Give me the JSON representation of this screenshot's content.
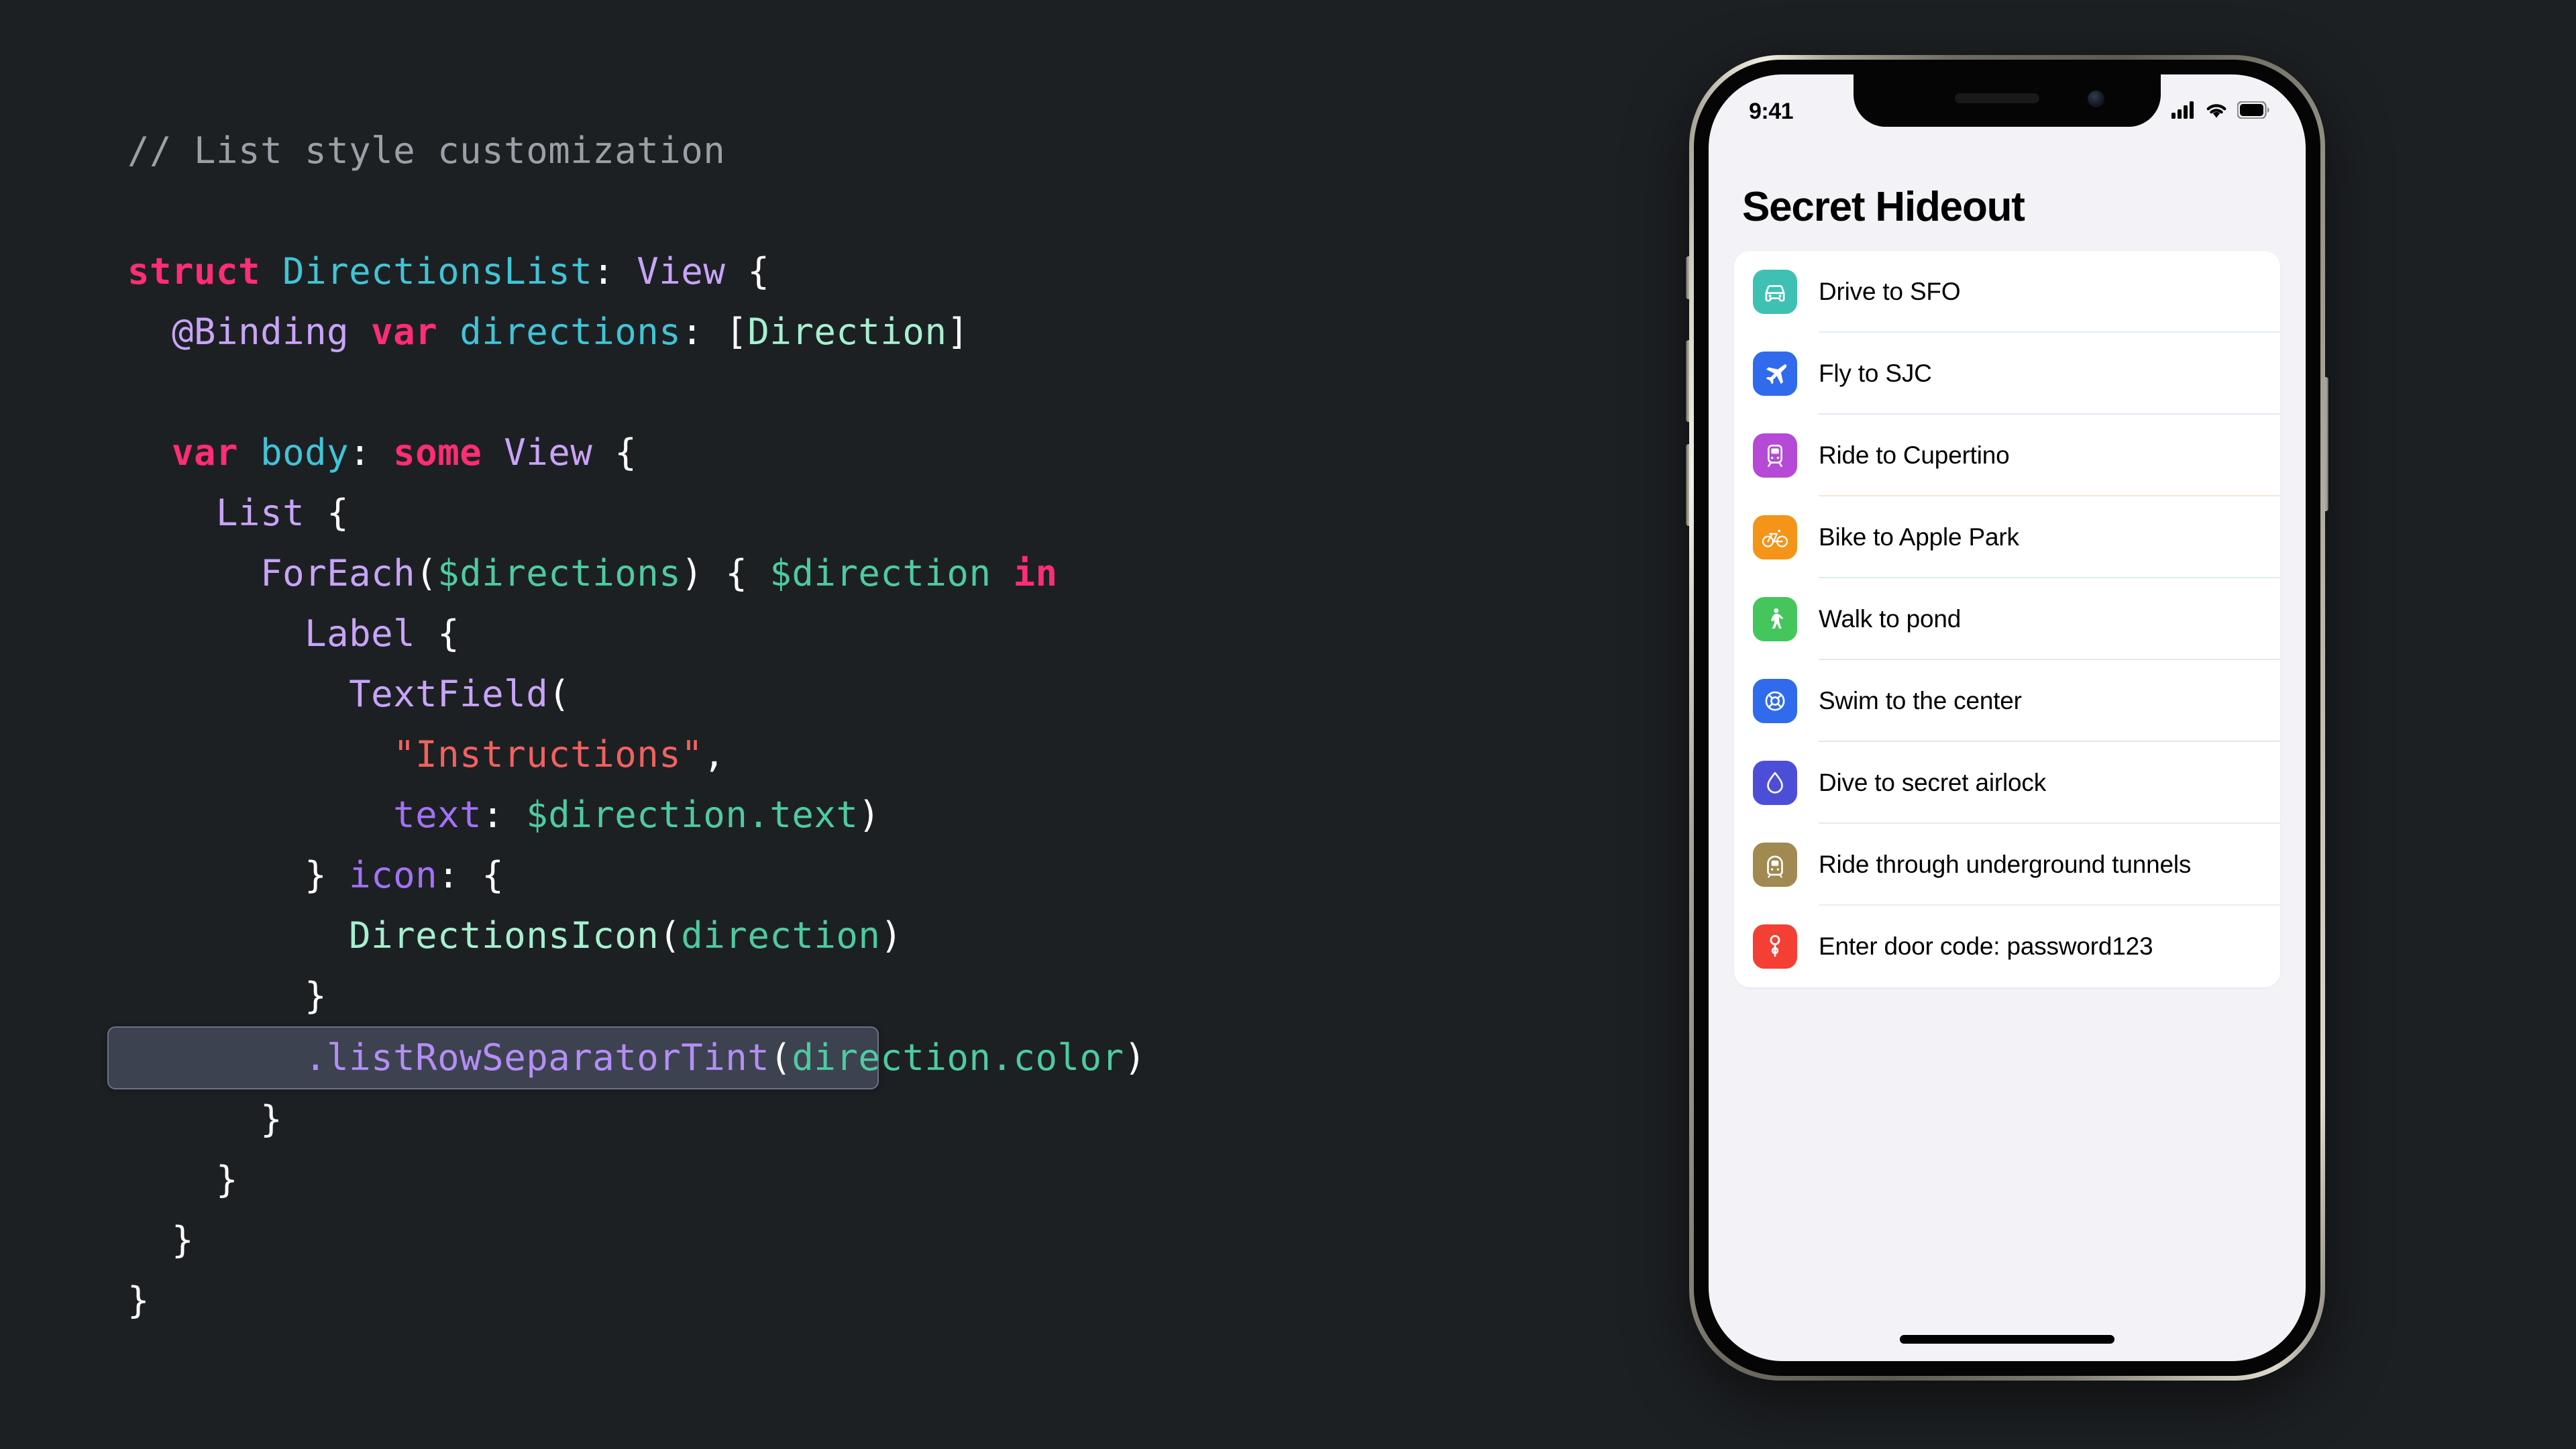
{
  "theme": {
    "background": "#1d2023",
    "code_text": "#ffffff",
    "highlight_bg": "#3d4250",
    "highlight_border": "#6b7287"
  },
  "code": {
    "language": "Swift",
    "lines": [
      {
        "id": "l1",
        "indent": 0,
        "highlighted": false,
        "tokens": [
          {
            "t": "// List style customization",
            "c": "tok-comment"
          }
        ]
      },
      {
        "id": "l2",
        "indent": 0,
        "highlighted": false,
        "blank": true,
        "tokens": [
          {
            "t": " ",
            "c": "tok-plain"
          }
        ]
      },
      {
        "id": "l3",
        "indent": 0,
        "highlighted": false,
        "tokens": [
          {
            "t": "struct",
            "c": "tok-keyword"
          },
          {
            "t": " ",
            "c": "tok-plain"
          },
          {
            "t": "DirectionsList",
            "c": "tok-type"
          },
          {
            "t": ": ",
            "c": "tok-plain"
          },
          {
            "t": "View",
            "c": "tok-viewtype"
          },
          {
            "t": " {",
            "c": "tok-plain"
          }
        ]
      },
      {
        "id": "l4",
        "indent": 1,
        "highlighted": false,
        "tokens": [
          {
            "t": "@Binding",
            "c": "tok-attr"
          },
          {
            "t": " ",
            "c": "tok-plain"
          },
          {
            "t": "var",
            "c": "tok-keyword"
          },
          {
            "t": " ",
            "c": "tok-plain"
          },
          {
            "t": "directions",
            "c": "tok-type"
          },
          {
            "t": ": [",
            "c": "tok-plain"
          },
          {
            "t": "Direction",
            "c": "tok-prop"
          },
          {
            "t": "]",
            "c": "tok-plain"
          }
        ]
      },
      {
        "id": "l5",
        "indent": 0,
        "highlighted": false,
        "blank": true,
        "tokens": [
          {
            "t": " ",
            "c": "tok-plain"
          }
        ]
      },
      {
        "id": "l6",
        "indent": 1,
        "highlighted": false,
        "tokens": [
          {
            "t": "var",
            "c": "tok-keyword"
          },
          {
            "t": " ",
            "c": "tok-plain"
          },
          {
            "t": "body",
            "c": "tok-type"
          },
          {
            "t": ": ",
            "c": "tok-plain"
          },
          {
            "t": "some",
            "c": "tok-keyword"
          },
          {
            "t": " ",
            "c": "tok-plain"
          },
          {
            "t": "View",
            "c": "tok-viewtype"
          },
          {
            "t": " {",
            "c": "tok-plain"
          }
        ]
      },
      {
        "id": "l7",
        "indent": 2,
        "highlighted": false,
        "tokens": [
          {
            "t": "List",
            "c": "tok-viewtype"
          },
          {
            "t": " {",
            "c": "tok-plain"
          }
        ]
      },
      {
        "id": "l8",
        "indent": 3,
        "highlighted": false,
        "tokens": [
          {
            "t": "ForEach",
            "c": "tok-viewtype"
          },
          {
            "t": "(",
            "c": "tok-plain"
          },
          {
            "t": "$directions",
            "c": "tok-green"
          },
          {
            "t": ") { ",
            "c": "tok-plain"
          },
          {
            "t": "$direction",
            "c": "tok-green"
          },
          {
            "t": " ",
            "c": "tok-plain"
          },
          {
            "t": "in",
            "c": "tok-keyword"
          }
        ]
      },
      {
        "id": "l9",
        "indent": 4,
        "highlighted": false,
        "tokens": [
          {
            "t": "Label",
            "c": "tok-viewtype"
          },
          {
            "t": " {",
            "c": "tok-plain"
          }
        ]
      },
      {
        "id": "l10",
        "indent": 5,
        "highlighted": false,
        "tokens": [
          {
            "t": "TextField",
            "c": "tok-viewtype"
          },
          {
            "t": "(",
            "c": "tok-plain"
          }
        ]
      },
      {
        "id": "l11",
        "indent": 6,
        "highlighted": false,
        "tokens": [
          {
            "t": "\"Instructions\"",
            "c": "tok-string"
          },
          {
            "t": ",",
            "c": "tok-plain"
          }
        ]
      },
      {
        "id": "l12",
        "indent": 6,
        "highlighted": false,
        "tokens": [
          {
            "t": "text",
            "c": "tok-param"
          },
          {
            "t": ": ",
            "c": "tok-plain"
          },
          {
            "t": "$direction.text",
            "c": "tok-green"
          },
          {
            "t": ")",
            "c": "tok-plain"
          }
        ]
      },
      {
        "id": "l13",
        "indent": 4,
        "highlighted": false,
        "tokens": [
          {
            "t": "} ",
            "c": "tok-plain"
          },
          {
            "t": "icon",
            "c": "tok-param"
          },
          {
            "t": ": {",
            "c": "tok-plain"
          }
        ]
      },
      {
        "id": "l14",
        "indent": 5,
        "highlighted": false,
        "tokens": [
          {
            "t": "DirectionsIcon",
            "c": "tok-prop"
          },
          {
            "t": "(",
            "c": "tok-plain"
          },
          {
            "t": "direction",
            "c": "tok-green"
          },
          {
            "t": ")",
            "c": "tok-plain"
          }
        ]
      },
      {
        "id": "l15",
        "indent": 4,
        "highlighted": false,
        "tokens": [
          {
            "t": "}",
            "c": "tok-plain"
          }
        ]
      },
      {
        "id": "l16",
        "indent": 4,
        "highlighted": true,
        "tokens": [
          {
            "t": ".listRowSeparatorTint",
            "c": "tok-method"
          },
          {
            "t": "(",
            "c": "tok-plain"
          },
          {
            "t": "direction.color",
            "c": "tok-green"
          },
          {
            "t": ")",
            "c": "tok-plain"
          }
        ]
      },
      {
        "id": "l17",
        "indent": 3,
        "highlighted": false,
        "tokens": [
          {
            "t": "}",
            "c": "tok-plain"
          }
        ]
      },
      {
        "id": "l18",
        "indent": 2,
        "highlighted": false,
        "tokens": [
          {
            "t": "}",
            "c": "tok-plain"
          }
        ]
      },
      {
        "id": "l19",
        "indent": 1,
        "highlighted": false,
        "tokens": [
          {
            "t": "}",
            "c": "tok-plain"
          }
        ]
      },
      {
        "id": "l20",
        "indent": 0,
        "highlighted": false,
        "tokens": [
          {
            "t": "}",
            "c": "tok-plain"
          }
        ]
      }
    ]
  },
  "phone": {
    "status": {
      "time": "9:41",
      "cellular_icon": "cellular-bars-icon",
      "wifi_icon": "wifi-icon",
      "battery_icon": "battery-icon"
    },
    "nav_title": "Secret Hideout",
    "home_indicator": "home-indicator",
    "buttons": [
      {
        "name": "mute-switch"
      },
      {
        "name": "volume-up-button"
      },
      {
        "name": "volume-down-button"
      },
      {
        "name": "power-button"
      }
    ],
    "list": [
      {
        "label": "Drive to SFO",
        "icon": "car-icon",
        "icon_bg": "#3ec1b3",
        "separator": "#dff0f7"
      },
      {
        "label": "Fly to SJC",
        "icon": "airplane-icon",
        "icon_bg": "#2f6bec",
        "separator": "#ece3f2"
      },
      {
        "label": "Ride to Cupertino",
        "icon": "tram-icon",
        "icon_bg": "#b44ad6",
        "separator": "#f6e6d6"
      },
      {
        "label": "Bike to Apple Park",
        "icon": "bicycle-icon",
        "icon_bg": "#f49419",
        "separator": "#dff0e7"
      },
      {
        "label": "Walk to pond",
        "icon": "walk-icon",
        "icon_bg": "#44c65c",
        "separator": "#e2e6f5"
      },
      {
        "label": "Swim to the center",
        "icon": "lifepreserver-icon",
        "icon_bg": "#2f6bec",
        "separator": "#e8e2f5"
      },
      {
        "label": "Dive to secret airlock",
        "icon": "drop-icon",
        "icon_bg": "#4d4ed8",
        "separator": "#ebe9e3"
      },
      {
        "label": "Ride through underground tunnels",
        "icon": "subway-icon",
        "icon_bg": "#a08a52",
        "separator": "#e9edf2"
      },
      {
        "label": "Enter door code: password123",
        "icon": "key-icon",
        "icon_bg": "#f43f34",
        "separator": "transparent"
      }
    ]
  }
}
